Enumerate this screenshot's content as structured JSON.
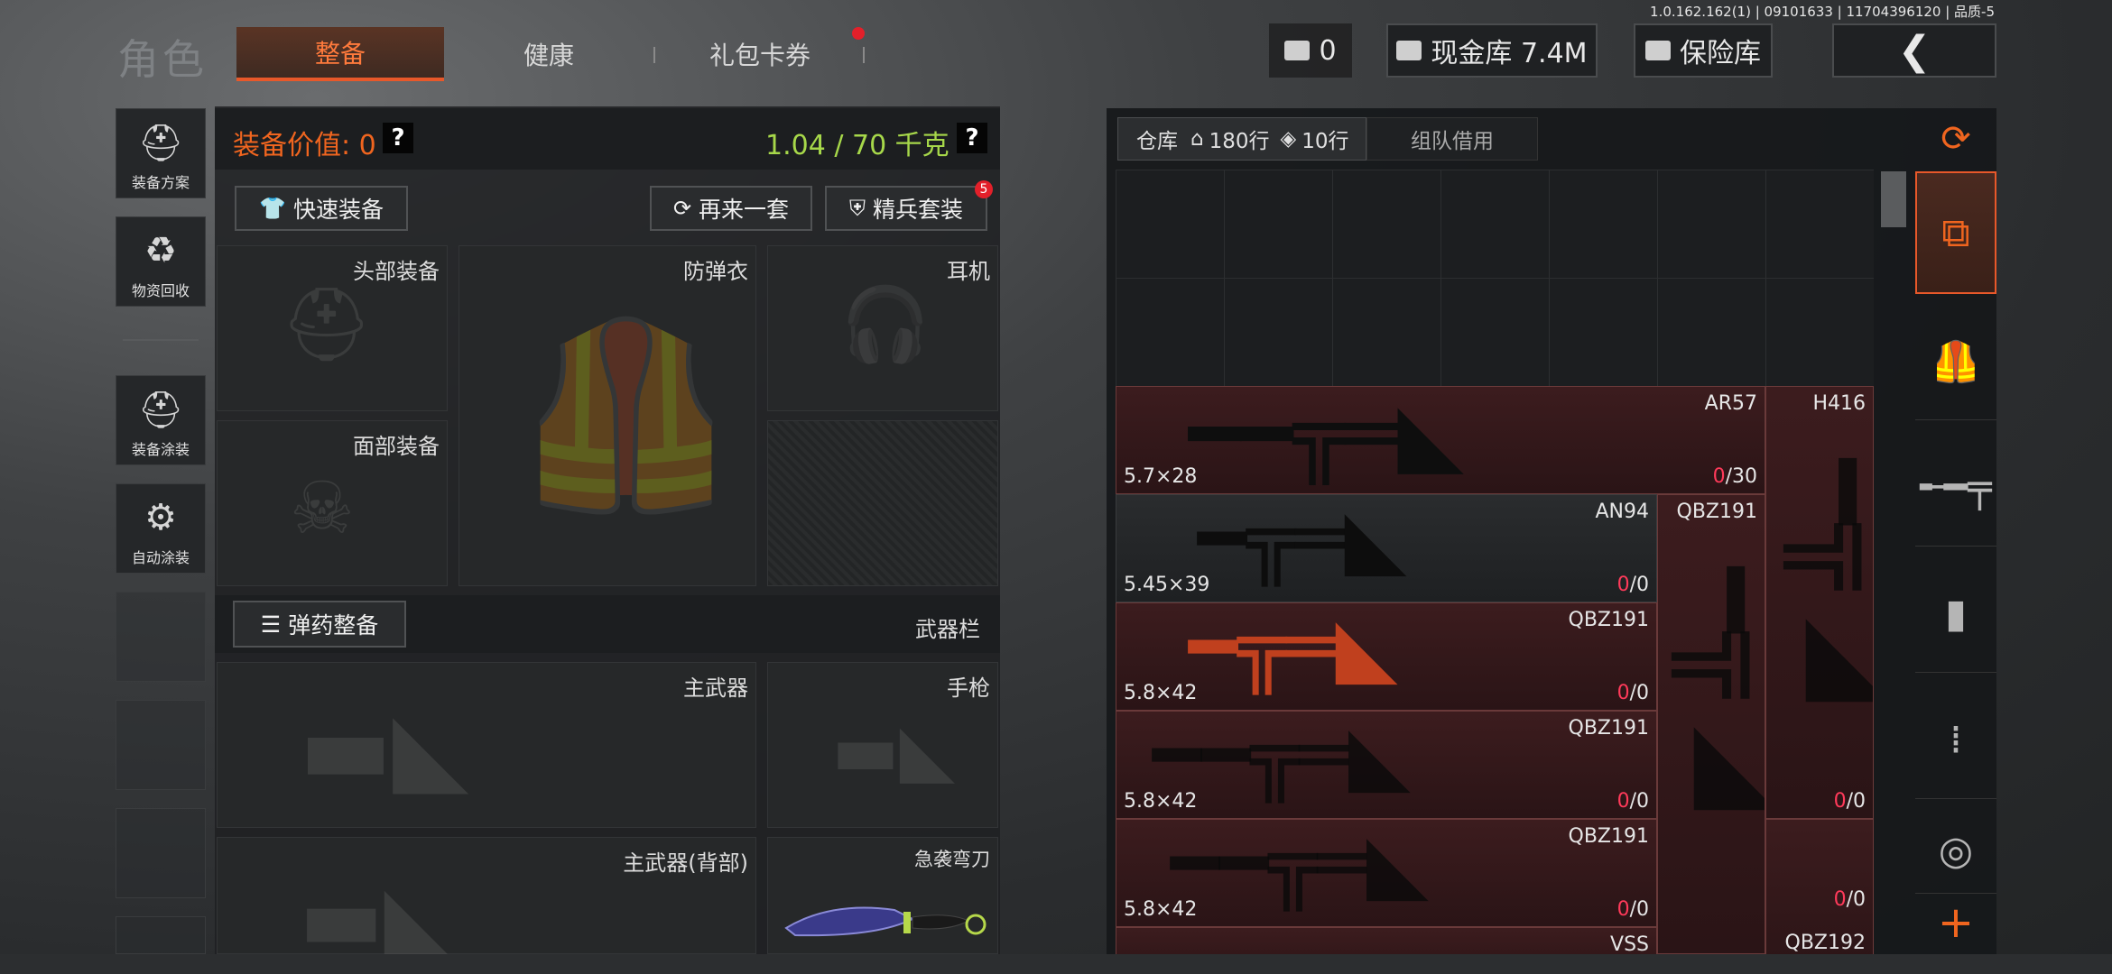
{
  "version": "1.0.162.162(1) | 09101633 | 11704396120 | 品质-5",
  "page_title": "角色",
  "tabs": [
    {
      "label": "整备",
      "active": true
    },
    {
      "label": "健康",
      "active": false
    },
    {
      "label": "礼包卡券",
      "active": false,
      "notify": true
    }
  ],
  "header": {
    "cash_value": "0",
    "cash_stash": "现金库 7.4M",
    "safe_box": "保险库"
  },
  "rail": [
    {
      "label": "装备方案",
      "icon": "loadout-plan-icon"
    },
    {
      "label": "物资回收",
      "icon": "recycle-icon"
    },
    {
      "label": "装备涂装",
      "icon": "skin-icon"
    },
    {
      "label": "自动涂装",
      "icon": "auto-skin-icon"
    }
  ],
  "loadout": {
    "value_label": "装备价值: 0",
    "weight_label": "1.04 / 70 千克",
    "help": "?",
    "quick_equip": "快速装备",
    "again": "再来一套",
    "elite": "精兵套装",
    "elite_badge": "5",
    "ammo_button": "弹药整备",
    "weapon_bar": "武器栏",
    "slots": {
      "head": "头部装备",
      "armor": "防弹衣",
      "headset": "耳机",
      "face": "面部装备",
      "primary": "主武器",
      "pistol": "手枪",
      "primary_back": "主武器(背部)",
      "melee": "急袭弯刀"
    }
  },
  "stash": {
    "tab_storage": "仓库",
    "storage_rows": "180行",
    "storage_rows2": "10行",
    "tab_team": "组队借用",
    "items": [
      {
        "name": "AR57",
        "caliber": "5.7×28",
        "ammo_cur": "0",
        "ammo_max": "/30"
      },
      {
        "name": "H416",
        "caliber": "",
        "ammo_cur": "0",
        "ammo_max": "/0"
      },
      {
        "name": "AN94",
        "caliber": "5.45×39",
        "ammo_cur": "0",
        "ammo_max": "/0"
      },
      {
        "name": "QBZ191",
        "caliber": "",
        "ammo_cur": "",
        "ammo_max": ""
      },
      {
        "name": "QBZ191",
        "caliber": "5.8×42",
        "ammo_cur": "0",
        "ammo_max": "/0"
      },
      {
        "name": "QBZ191",
        "caliber": "5.8×42",
        "ammo_cur": "0",
        "ammo_max": "/0"
      },
      {
        "name": "QBZ191",
        "caliber": "5.8×42",
        "ammo_cur": "0",
        "ammo_max": "/0"
      },
      {
        "name": "VSS",
        "caliber": "",
        "ammo_cur": "",
        "ammo_max": ""
      },
      {
        "name": "QBZ192",
        "caliber": "",
        "ammo_cur": "",
        "ammo_max": ""
      }
    ]
  },
  "colors": {
    "accent": "#f0651f",
    "weight": "#a7d84a",
    "alert": "#e3202a",
    "ammo_empty": "#ff3a5a"
  }
}
